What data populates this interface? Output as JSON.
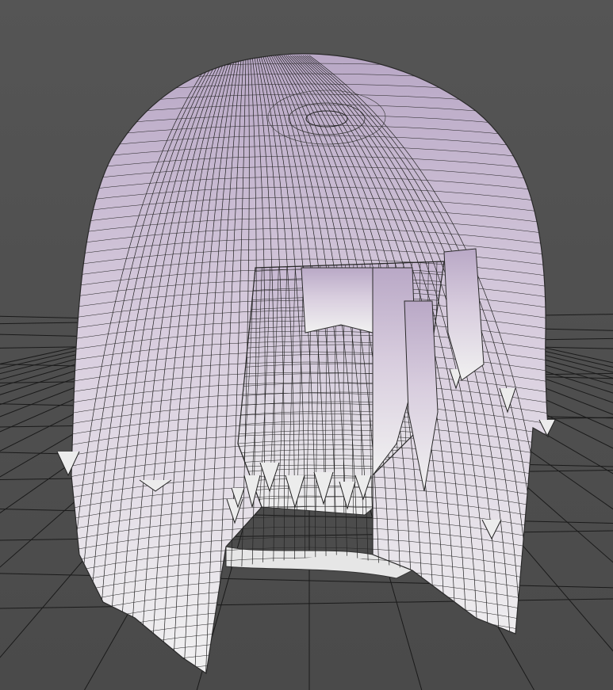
{
  "viewport": {
    "background_color": "#4d4d4d",
    "grid_line_color": "#1a1a1a",
    "mesh_top_color": "#b9a8c6",
    "mesh_bottom_color": "#f1f1f1",
    "wire_color": "#222222"
  },
  "model": {
    "icon": "hair-mesh-icon"
  }
}
